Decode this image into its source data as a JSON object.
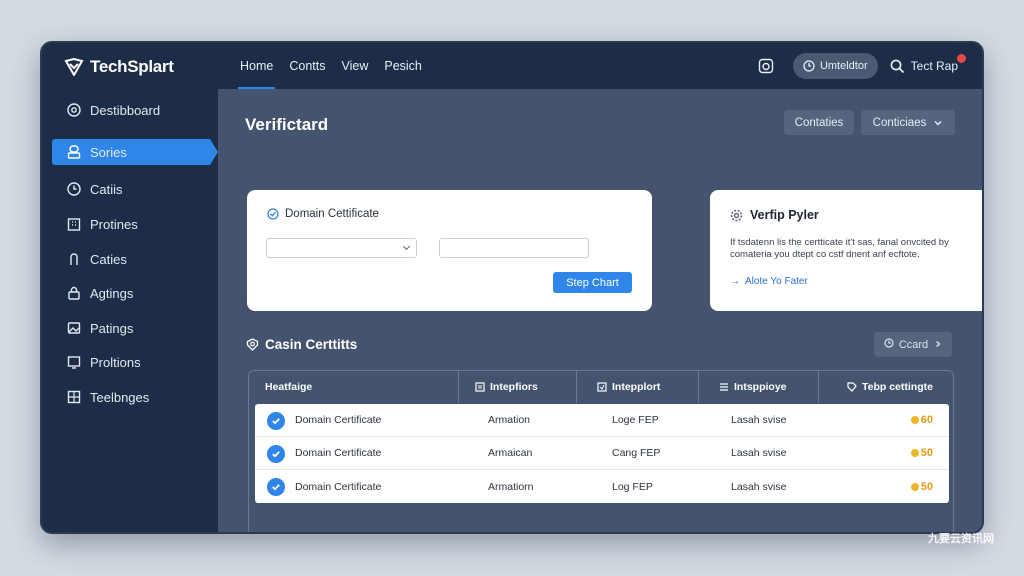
{
  "brand": {
    "name": "TechSplart"
  },
  "sidebar": {
    "items": [
      {
        "label": "Destibboard",
        "icon": "gauge-icon",
        "active": false
      },
      {
        "label": "Sories",
        "icon": "user-icon",
        "active": true
      },
      {
        "label": "Catiis",
        "icon": "clock-icon",
        "active": false
      },
      {
        "label": "Protines",
        "icon": "building-icon",
        "active": false
      },
      {
        "label": "Caties",
        "icon": "hook-icon",
        "active": false
      },
      {
        "label": "Agtings",
        "icon": "lock-icon",
        "active": false
      },
      {
        "label": "Patings",
        "icon": "image-icon",
        "active": false
      },
      {
        "label": "Proltions",
        "icon": "monitor-icon",
        "active": false
      },
      {
        "label": "Teelbnges",
        "icon": "grid-icon",
        "active": false
      }
    ]
  },
  "topbar": {
    "tabs": [
      "Home",
      "Contts",
      "View",
      "Pesich"
    ],
    "pill_label": "Umteldtor",
    "user_label": "Tect Rap"
  },
  "main": {
    "title": "Verifictard",
    "buttons": [
      "Contaties",
      "Conticiaes"
    ],
    "domain_card": {
      "title": "Domain Cettificate",
      "select_value": "",
      "input_value": "",
      "button_label": "Step Chart"
    },
    "verify_card": {
      "title": "Verfip Pyler",
      "description": "If tsdatenn lis the certticate it't sas, fanal onvcited by comateria you dtept co cstf dnent anf ecftote.",
      "link": "Alote Yo Fater"
    },
    "section": {
      "title": "Casin Certtitts",
      "button": "Ccard"
    },
    "table": {
      "columns": [
        "Heatfaige",
        "Intepfiors",
        "Intepplort",
        "Intsppioye",
        "Tebp cettingte"
      ],
      "rows": [
        {
          "name": "Domain Certificate",
          "col2": "Armation",
          "col3": "Loge FEP",
          "col4": "Lasah svise",
          "score": "60"
        },
        {
          "name": "Domain Certificate",
          "col2": "Armaican",
          "col3": "Cang FEP",
          "col4": "Lasah svise",
          "score": "50"
        },
        {
          "name": "Domain Certificate",
          "col2": "Armatiorn",
          "col3": "Log FEP",
          "col4": "Lasah svise",
          "score": "50"
        }
      ]
    }
  },
  "watermark": "九要云资讯网",
  "colors": {
    "accent": "#2f86e8",
    "sidebar": "#1d2d47",
    "content": "#44546e",
    "score": "#e29a16"
  }
}
